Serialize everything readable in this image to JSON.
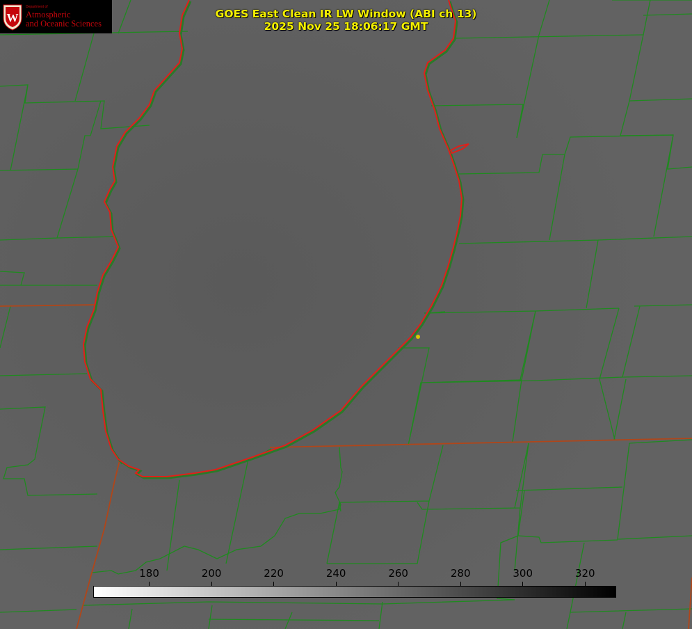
{
  "title": {
    "line1": "GOES East Clean IR LW Window (ABI ch 13)",
    "line2": "2025 Nov 25 18:06:17 GMT"
  },
  "logo": {
    "dept": "Department of",
    "line1": "Atmospheric",
    "line2": "and Oceanic Sciences",
    "crest_letter": "W"
  },
  "colorbar": {
    "ticks": [
      "180",
      "200",
      "220",
      "240",
      "260",
      "280",
      "300",
      "320"
    ],
    "range": [
      162,
      330
    ]
  },
  "colors": {
    "background": "#5e5e5e",
    "county_lines": "#1f8a1f",
    "state_lines": "#b0461a",
    "lake_outline": "#e0201a",
    "title": "#f4f000",
    "marker": "#d8c800",
    "logo_red": "#c5050c"
  }
}
